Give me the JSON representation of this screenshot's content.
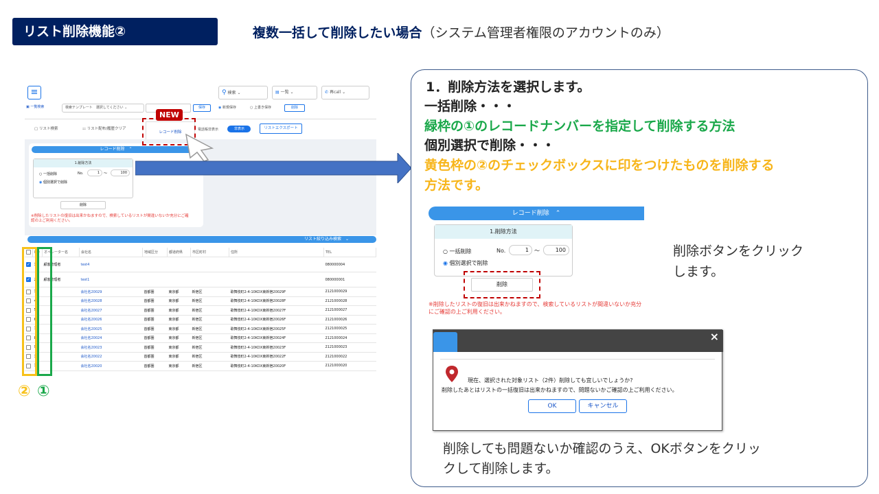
{
  "header": {
    "badge": "リスト削除機能②",
    "heading_main": "複数一括して削除したい場合",
    "heading_sub": "（システム管理者権限のアカウントのみ）"
  },
  "app": {
    "search_label": "検索",
    "list_label": "一覧",
    "call_label": "再call",
    "bulk_search": "一覧検索",
    "template_label": "検索テンプレート",
    "template_value": "選択してください",
    "save": "保存",
    "new_save": "新規保存",
    "overwrite": "上書き保存",
    "delete_small": "削除",
    "tabs": [
      "リスト検索",
      "リスト配布/履歴クリア",
      "レコード削除"
    ],
    "recall_label": "電話帳非表示",
    "toggle_label": "非表示",
    "export_btn": "リストエクスポート",
    "new_badge": "NEW",
    "record_delete_bar": "レコード削除　⌃",
    "method_title": "1.削除方法",
    "opt_bulk": "一括削除",
    "opt_individual": "個別選択で削除",
    "no_label": "No.",
    "from_value": "1",
    "tilde": "～",
    "to_value": "100",
    "delete_button": "削除",
    "warning": "※削除したリストの復旧は出来かねますので、検索しているリストが間違いないか充分にご確認の上ご利用ください。",
    "filter_bar": "リスト絞り込み検索　⌄",
    "columns": [
      "NO",
      "オペレーター名",
      "会社名",
      "地域区分",
      "都道府県",
      "市区町村",
      "住所",
      "TEL"
    ],
    "rows": [
      {
        "no": "1",
        "op": "顧客管理者",
        "company": "test4",
        "region": "",
        "pref": "",
        "city": "",
        "addr": "",
        "tel": "080000004",
        "checked": true
      },
      {
        "no": "2",
        "op": "顧客管理者",
        "company": "test1",
        "region": "",
        "pref": "",
        "city": "",
        "addr": "",
        "tel": "080000001",
        "checked": true
      },
      {
        "no": "3",
        "op": "",
        "company": "会社名20029",
        "region": "首都圏",
        "pref": "東京都",
        "city": "新宿区",
        "addr": "歌舞伎町2-4-10KDX東新宿20029F",
        "tel": "2121000029",
        "checked": false
      },
      {
        "no": "4",
        "op": "",
        "company": "会社名20028",
        "region": "首都圏",
        "pref": "東京都",
        "city": "新宿区",
        "addr": "歌舞伎町2-4-10KDX東新宿20028F",
        "tel": "2121000028",
        "checked": false
      },
      {
        "no": "5",
        "op": "",
        "company": "会社名20027",
        "region": "首都圏",
        "pref": "東京都",
        "city": "新宿区",
        "addr": "歌舞伎町2-4-10KDX東新宿20027F",
        "tel": "2121000027",
        "checked": false
      },
      {
        "no": "6",
        "op": "",
        "company": "会社名20026",
        "region": "首都圏",
        "pref": "東京都",
        "city": "新宿区",
        "addr": "歌舞伎町2-4-10KDX東新宿20026F",
        "tel": "2121000026",
        "checked": false
      },
      {
        "no": "7",
        "op": "",
        "company": "会社名20025",
        "region": "首都圏",
        "pref": "東京都",
        "city": "新宿区",
        "addr": "歌舞伎町2-4-10KDX東新宿20025F",
        "tel": "2121000025",
        "checked": false
      },
      {
        "no": "8",
        "op": "",
        "company": "会社名20024",
        "region": "首都圏",
        "pref": "東京都",
        "city": "新宿区",
        "addr": "歌舞伎町2-4-10KDX東新宿20024F",
        "tel": "2121000024",
        "checked": false
      },
      {
        "no": "9",
        "op": "",
        "company": "会社名20023",
        "region": "首都圏",
        "pref": "東京都",
        "city": "新宿区",
        "addr": "歌舞伎町2-4-10KDX東新宿20023F",
        "tel": "2121000023",
        "checked": false
      },
      {
        "no": "10",
        "op": "",
        "company": "会社名20022",
        "region": "首都圏",
        "pref": "東京都",
        "city": "新宿区",
        "addr": "歌舞伎町2-4-10KDX東新宿20022F",
        "tel": "2121000022",
        "checked": false
      },
      {
        "no": "11",
        "op": "",
        "company": "会社名20020",
        "region": "首都圏",
        "pref": "東京都",
        "city": "新宿区",
        "addr": "歌舞伎町2-4-10KDX東新宿20020F",
        "tel": "2121000020",
        "checked": false
      }
    ]
  },
  "markers": {
    "two": "②",
    "one": "①"
  },
  "panel": {
    "step": "1．削除方法を選択します。",
    "line_bulk": "一括削除・・・",
    "line_green": "緑枠の①のレコードナンバーを指定して削除する方法",
    "line_individual": "個別選択で削除・・・",
    "line_yellow_1": "黄色枠の②のチェックボックスに印をつけたものを削除する",
    "line_yellow_2": "方法です。",
    "click_delete_1": "削除ボタンをクリック",
    "click_delete_2": "します。",
    "confirm_1": "削除しても問題ないか確認のうえ、OKボタンをクリッ",
    "confirm_2": "クして削除します。"
  },
  "dialog": {
    "close": "×",
    "message_1": "現在、選択された対象リスト（2件）削除しても宜しいでしょうか?",
    "message_2": "削除したあとはリストの一括復旧は出来かねますので、問題ないかご確認の上ご利用ください。",
    "ok": "OK",
    "cancel": "キャンセル"
  },
  "colors": {
    "navy": "#002060",
    "green": "#1aa84a",
    "yellow": "#f7b51a",
    "red": "#c00000",
    "blue": "#3a95e8"
  }
}
